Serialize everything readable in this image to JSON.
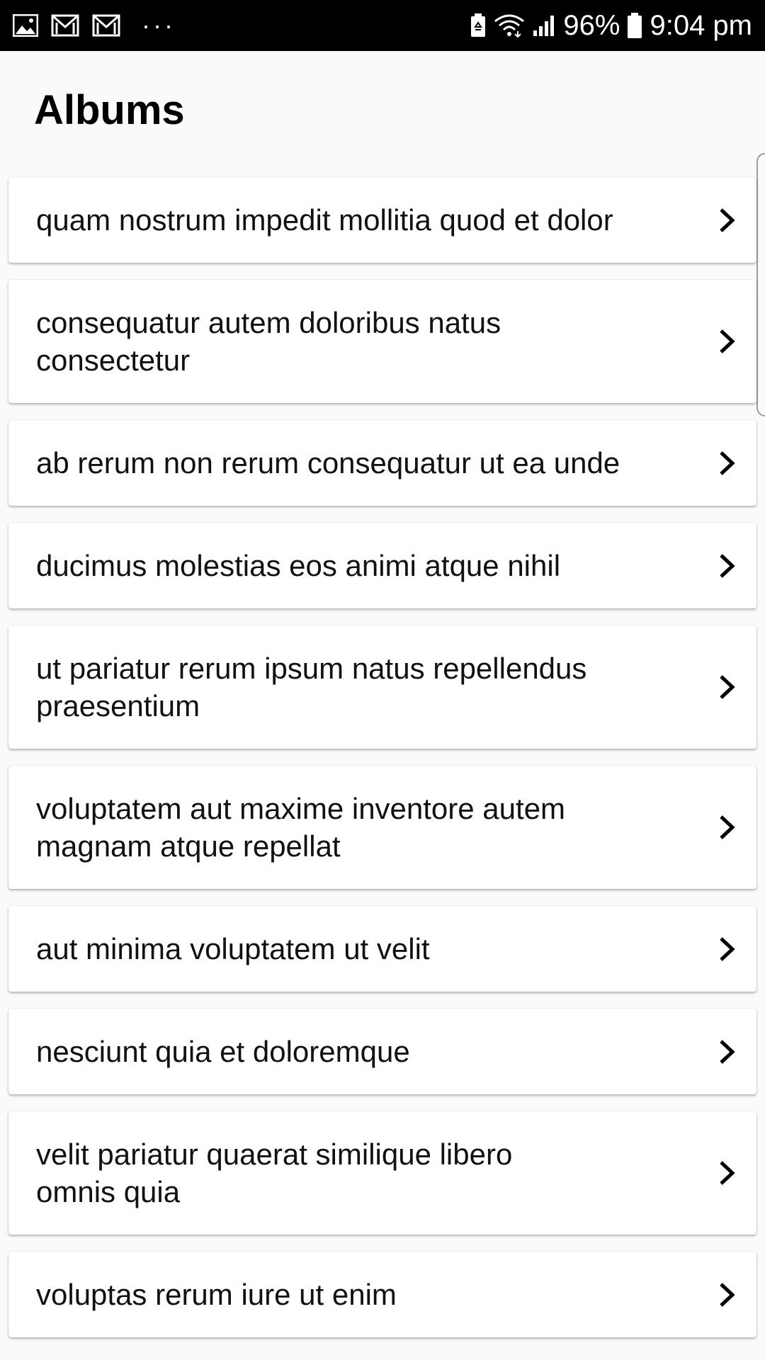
{
  "status_bar": {
    "icons": [
      "image-icon",
      "gmail-icon",
      "gmail-icon",
      "more-dots-icon",
      "battery-saver-icon",
      "wifi-icon",
      "signal-icon",
      "battery-icon"
    ],
    "overflow": "···",
    "battery_percent": "96%",
    "time": "9:04 pm"
  },
  "page": {
    "title": "Albums"
  },
  "albums": [
    {
      "label": "quam nostrum impedit mollitia quod et dolor"
    },
    {
      "label": "consequatur autem doloribus natus\nconsectetur"
    },
    {
      "label": "ab rerum non rerum consequatur ut ea unde"
    },
    {
      "label": "ducimus molestias eos animi atque nihil"
    },
    {
      "label": "ut pariatur rerum ipsum natus repellendus\npraesentium"
    },
    {
      "label": "voluptatem aut maxime inventore autem\nmagnam atque repellat"
    },
    {
      "label": "aut minima voluptatem ut velit"
    },
    {
      "label": "nesciunt quia et doloremque"
    },
    {
      "label": "velit pariatur quaerat similique libero\nomnis quia"
    },
    {
      "label": "voluptas rerum iure ut enim"
    }
  ],
  "colors": {
    "status_bar_bg": "#000000",
    "background": "#fafafa",
    "card_bg": "#ffffff",
    "text": "#111111"
  }
}
